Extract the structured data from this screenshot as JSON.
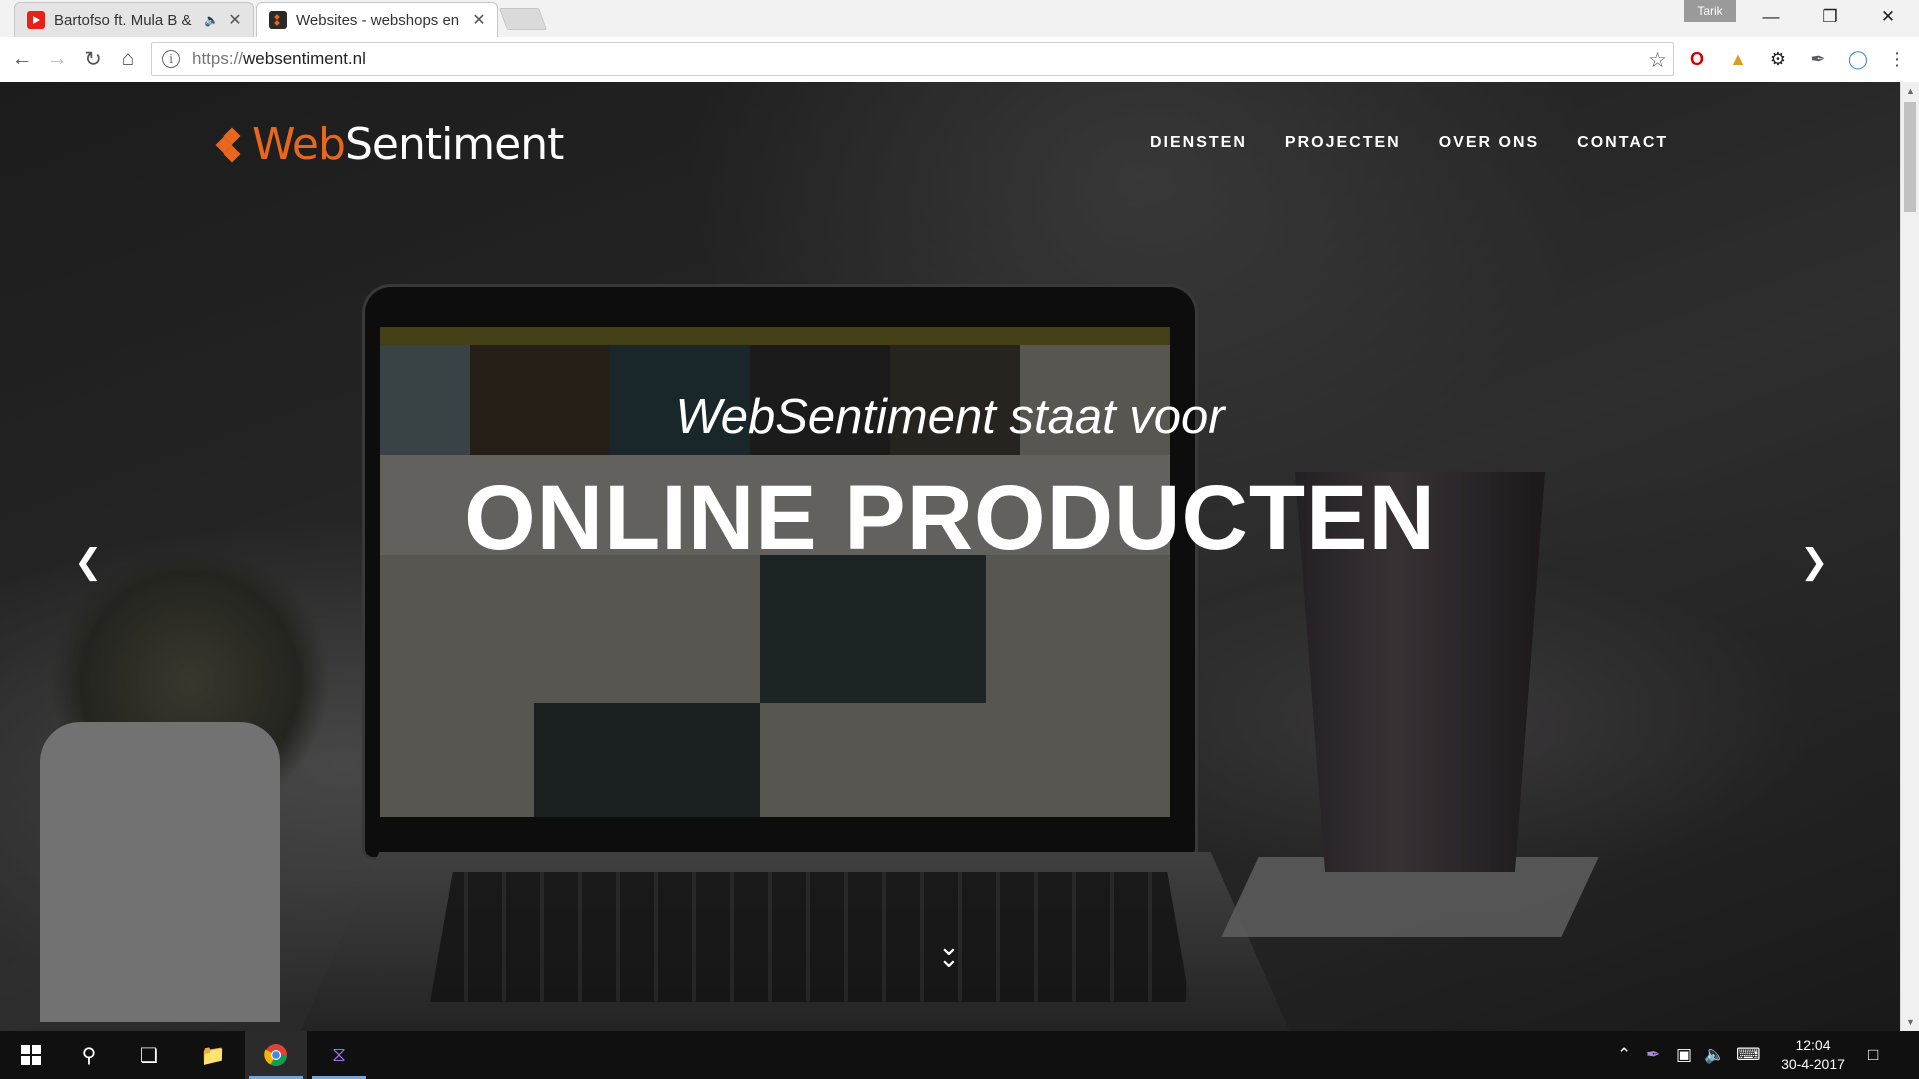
{
  "browser": {
    "tabs": [
      {
        "title": "Bartofso ft. Mula B &",
        "favicon": "youtube-icon",
        "audio": true,
        "active": false
      },
      {
        "title": "Websites - webshops en",
        "favicon": "websentiment-icon",
        "audio": false,
        "active": true
      }
    ],
    "profile_name": "Tarik",
    "url_scheme": "https://",
    "url_host": "websentiment.nl"
  },
  "site": {
    "logo_web": "Web",
    "logo_sentiment": "Sentiment",
    "nav": [
      "DIENSTEN",
      "PROJECTEN",
      "OVER ONS",
      "CONTACT"
    ],
    "hero_subtitle": "WebSentiment staat voor",
    "hero_title": "ONLINE PRODUCTEN",
    "accent_color": "#e8671c"
  },
  "taskbar": {
    "time": "12:04",
    "date": "30-4-2017"
  }
}
